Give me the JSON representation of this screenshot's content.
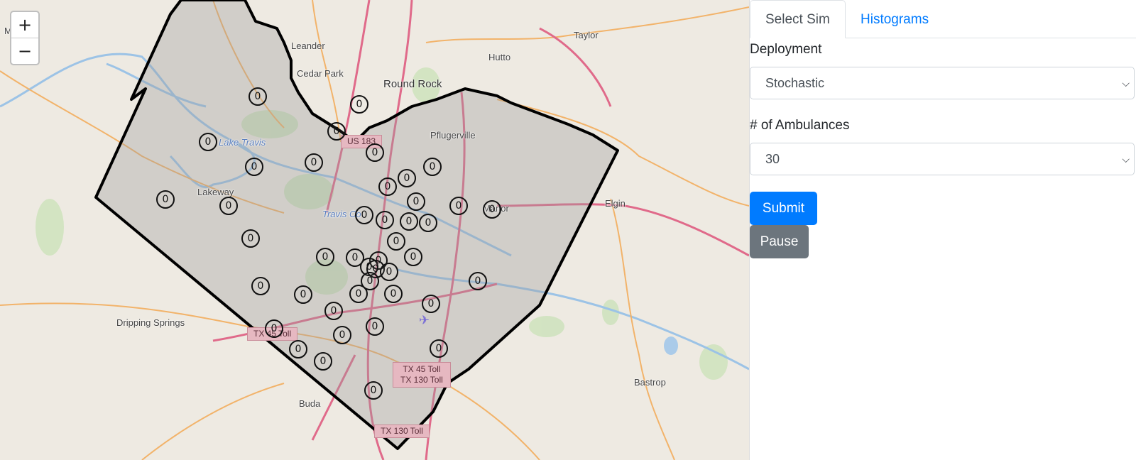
{
  "map": {
    "zoom_in": "+",
    "zoom_out": "−",
    "place_labels": [
      "M    Falls",
      "Leander",
      "Cedar Park",
      "Round Rock",
      "Hutto",
      "Taylor",
      "Pflugerville",
      "Lakeway",
      "Manor",
      "Elgin",
      "Dripping Springs",
      "Buda",
      "Bastrop"
    ],
    "water_labels": [
      "Lake Travis",
      "Travis Co"
    ],
    "road_labels": [
      "US 183",
      "TX 45 Toll",
      "TX 45 Toll\nTX 130 Toll",
      "TX 130 Toll"
    ],
    "station_count_label": "0"
  },
  "panel": {
    "tabs": [
      "Select Sim",
      "Histograms"
    ],
    "active_tab": "Select Sim",
    "deployment_label": "Deployment",
    "deployment_value": "Stochastic",
    "ambulances_label": "# of Ambulances",
    "ambulances_value": "30",
    "submit_label": "Submit",
    "pause_label": "Pause"
  },
  "colors": {
    "primary": "#007bff",
    "secondary": "#6c757d",
    "county_fill": "#9a9a9a",
    "major_road": "#e06a8a",
    "secondary_road": "#f2b36a"
  }
}
